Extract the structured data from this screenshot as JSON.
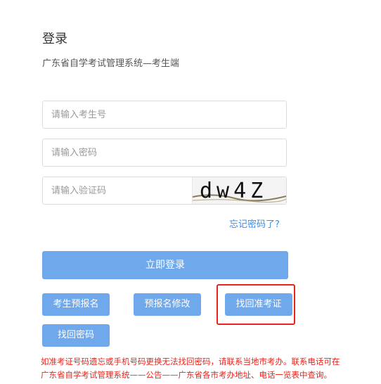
{
  "login": {
    "title": "登录",
    "subtitle": "广东省自学考试管理系统—考生端"
  },
  "form": {
    "candidate_id_placeholder": "请输入考生号",
    "password_placeholder": "请输入密码",
    "captcha_placeholder": "请输入验证码",
    "captcha_text": "dw4Z",
    "forgot_password_link": "忘记密码了?",
    "login_button": "立即登录"
  },
  "actions": {
    "pre_register": "考生预报名",
    "modify_pre_register": "预报名修改",
    "retrieve_admission_ticket": "找回准考证",
    "retrieve_password": "找回密码"
  },
  "notice": {
    "line1": "如准考证号码遗忘或手机号码更换无法找回密码，请联系当地市考办。联系电话可在",
    "line2": "广东省自学考试管理系统——公告——广东省各市考办地址、电话一览表中查询。"
  },
  "colors": {
    "primary_button": "#6fa9ec",
    "link": "#3a8ee6",
    "notice_text": "#e8241c",
    "highlight_box": "#e8241c"
  }
}
